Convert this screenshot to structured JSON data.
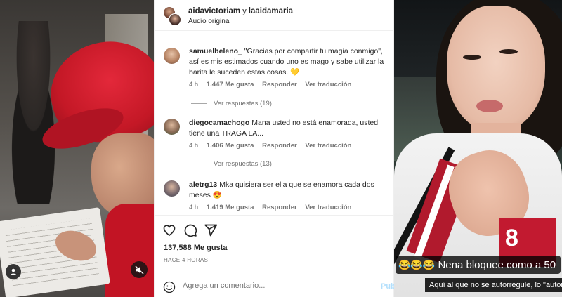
{
  "post_header": {
    "user1": "aidavictoriam",
    "conjunction": "y",
    "user2": "laaidamaria",
    "audio": "Audio original"
  },
  "comments": [
    {
      "username": "samuelbeleno_",
      "text": "\"Gracias por compartir tu magia conmigo\", así es mis estimados cuando uno es mago y sabe utilizar la barita le suceden estas cosas.",
      "emoji": "💛",
      "time": "4 h",
      "likes": "1.447 Me gusta",
      "reply": "Responder",
      "translate": "Ver traducción",
      "view_replies": "Ver respuestas (19)"
    },
    {
      "username": "diegocamachogo",
      "text": "Mana usted no está enamorada, usted tiene una TRAGA LA...",
      "emoji": "",
      "time": "4 h",
      "likes": "1.406 Me gusta",
      "reply": "Responder",
      "translate": "Ver traducción",
      "view_replies": "Ver respuestas (13)"
    },
    {
      "username": "aletrg13",
      "text": "Mka quisiera ser ella que se enamora cada dos meses",
      "emoji": "😍",
      "time": "4 h",
      "likes": "1.419 Me gusta",
      "reply": "Responder",
      "translate": "Ver traducción",
      "view_replies": ""
    }
  ],
  "actions": {
    "like_icon": "heart-icon",
    "comment_icon": "comment-bubble-icon",
    "share_icon": "paper-plane-icon"
  },
  "likes_total": "137,588 Me gusta",
  "time_ago": "HACE 4 HORAS",
  "add_comment": {
    "placeholder": "Agrega un comentario...",
    "publish": "Pub"
  },
  "overlay_captions": {
    "caption1_emojis": "😂😂😂",
    "caption1_text": "Nena bloquee como a 50",
    "caption2": "Aquí al que no se autorregule, lo \"autoregulo\""
  },
  "jacket_text": "8",
  "colors": {
    "accent_red": "#c41826",
    "meta_gray": "#737373",
    "publish_blue": "#b2dffc"
  }
}
